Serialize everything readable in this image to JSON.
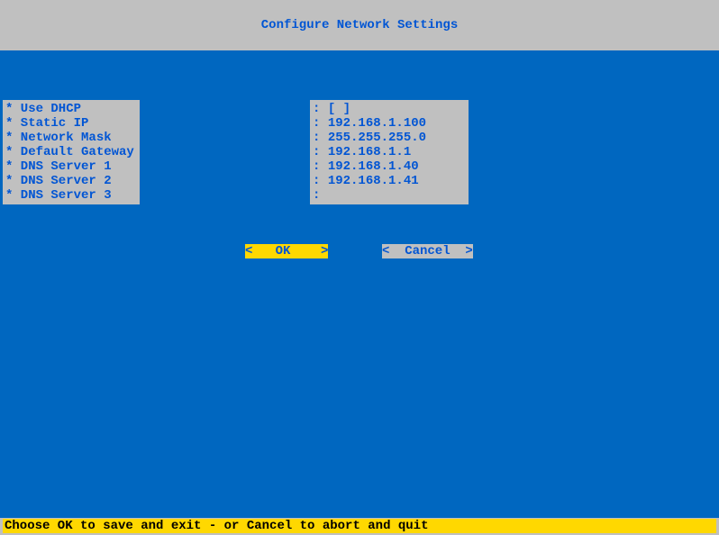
{
  "header": {
    "title": "Configure Network Settings"
  },
  "form": {
    "fields": [
      {
        "label": "* Use DHCP",
        "value": "[ ]"
      },
      {
        "label": "* Static IP",
        "value": "192.168.1.100"
      },
      {
        "label": "* Network Mask",
        "value": "255.255.255.0"
      },
      {
        "label": "* Default Gateway",
        "value": "192.168.1.1"
      },
      {
        "label": "* DNS Server 1",
        "value": "192.168.1.40"
      },
      {
        "label": "* DNS Server 2",
        "value": "192.168.1.41"
      },
      {
        "label": "* DNS Server 3",
        "value": ""
      }
    ]
  },
  "buttons": {
    "ok": "<   OK    >",
    "cancel": "<  Cancel  >"
  },
  "footer": {
    "hint": "Choose OK to save and exit - or Cancel to abort and quit"
  }
}
